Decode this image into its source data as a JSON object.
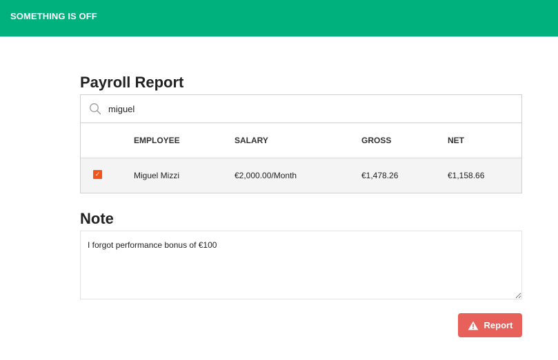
{
  "header": {
    "title": "SOMETHING IS OFF"
  },
  "payroll": {
    "title": "Payroll Report",
    "search": {
      "value": "miguel",
      "icon": "search-icon"
    },
    "columns": {
      "employee": "EMPLOYEE",
      "salary": "SALARY",
      "gross": "GROSS",
      "net": "NET"
    },
    "rows": [
      {
        "checked": true,
        "employee": "Miguel Mizzi",
        "salary": "€2,000.00/Month",
        "gross": "€1,478.26",
        "net": "€1,158.66"
      }
    ]
  },
  "note": {
    "title": "Note",
    "value": "I forgot performance bonus of €100"
  },
  "actions": {
    "report_label": "Report",
    "report_icon": "warning-icon"
  },
  "colors": {
    "header_bg": "#00b07d",
    "checkbox": "#f2541b",
    "report_button": "#e8605a"
  }
}
